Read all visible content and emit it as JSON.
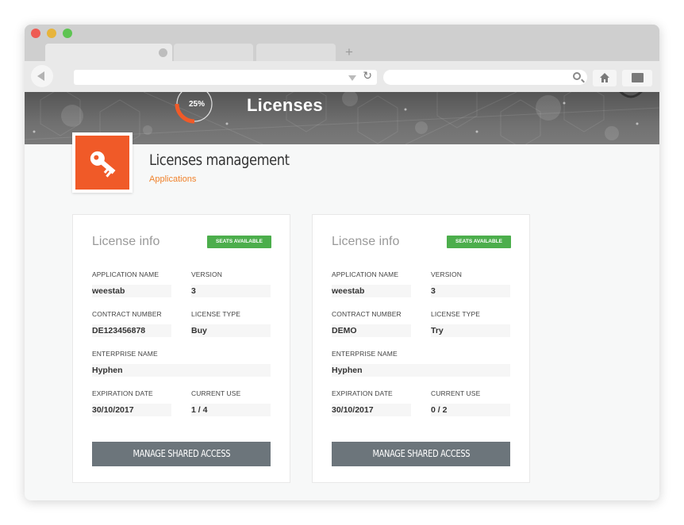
{
  "browser": {
    "new_tab_label": "+"
  },
  "banner": {
    "progress_text": "25%",
    "progress_value": 0.25,
    "title": "Licenses"
  },
  "header": {
    "title": "Licenses management",
    "breadcrumb": "Applications",
    "accent_color": "#f05a28"
  },
  "licenses": [
    {
      "card_title": "License info",
      "badge": "SEATS AVAILABLE",
      "application_name_label": "APPLICATION NAME",
      "application_name": "weestab",
      "version_label": "VERSION",
      "version": "3",
      "contract_number_label": "CONTRACT NUMBER",
      "contract_number": "DE123456878",
      "license_type_label": "LICENSE TYPE",
      "license_type": "Buy",
      "enterprise_name_label": "ENTERPRISE NAME",
      "enterprise_name": "Hyphen",
      "expiration_date_label": "EXPIRATION DATE",
      "expiration_date": "30/10/2017",
      "current_use_label": "CURRENT USE",
      "current_use": "1 / 4",
      "button_label": "MANAGE SHARED ACCESS"
    },
    {
      "card_title": "License info",
      "badge": "SEATS AVAILABLE",
      "application_name_label": "APPLICATION NAME",
      "application_name": "weestab",
      "version_label": "VERSION",
      "version": "3",
      "contract_number_label": "CONTRACT NUMBER",
      "contract_number": "DEMO",
      "license_type_label": "LICENSE TYPE",
      "license_type": "Try",
      "enterprise_name_label": "ENTERPRISE NAME",
      "enterprise_name": "Hyphen",
      "expiration_date_label": "EXPIRATION DATE",
      "expiration_date": "30/10/2017",
      "current_use_label": "CURRENT USE",
      "current_use": "0 / 2",
      "button_label": "MANAGE SHARED ACCESS"
    }
  ],
  "colors": {
    "badge_green": "#4cae4c",
    "button_gray": "#6c757b",
    "breadcrumb_orange": "#f0822c"
  },
  "icons": [
    "back-arrow-icon",
    "dropdown-arrow-icon",
    "reload-icon",
    "search-icon",
    "home-icon",
    "tabs-icon",
    "key-icon"
  ]
}
